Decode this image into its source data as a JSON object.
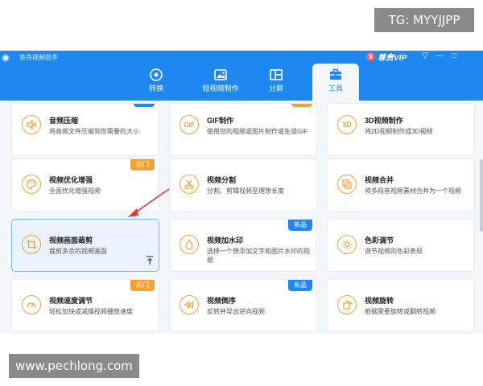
{
  "overlay": {
    "top_right": "TG: MYYJJPP",
    "bottom_left": "www.pechlong.com"
  },
  "window": {
    "title": "金舟视频助手",
    "vip_label": "尊贵VIP",
    "controls": [
      "▽",
      "—",
      "□"
    ]
  },
  "tabs": [
    {
      "label": "转换",
      "icon": "convert-icon",
      "active": false
    },
    {
      "label": "短视频制作",
      "icon": "short-video-icon",
      "active": false
    },
    {
      "label": "分屏",
      "icon": "split-screen-icon",
      "active": false
    },
    {
      "label": "工具",
      "icon": "toolbox-icon",
      "active": true
    }
  ],
  "cards": [
    {
      "title": "音频压缩",
      "desc": "将音频文件压缩到您需要的大小",
      "icon": "audio-compress-icon",
      "badge": "blank-blue"
    },
    {
      "title": "GIF制作",
      "desc": "使用您的视频或图片制作或生成GIF",
      "icon": "gif-icon",
      "icon_text": "GIF",
      "badge": "blank-orange"
    },
    {
      "title": "3D视频制作",
      "desc": "将2D视频制作成3D视频",
      "icon": "3d-icon",
      "icon_text": "3D",
      "badge": ""
    },
    {
      "title": "视频优化增强",
      "desc": "全面优化增强视频",
      "icon": "palette-icon",
      "badge": "热门"
    },
    {
      "title": "视频分割",
      "desc": "分割、剪辑视频至理想长度",
      "icon": "scissors-icon",
      "badge": ""
    },
    {
      "title": "视频合并",
      "desc": "将多段音视频素材合并为一个视频",
      "icon": "merge-icon",
      "badge": ""
    },
    {
      "title": "视频画面裁剪",
      "desc": "裁剪多余的视频画面",
      "icon": "crop-icon",
      "badge": "",
      "selected": true
    },
    {
      "title": "视频加水印",
      "desc": "选择一个想添加文字和图片水印的视频",
      "icon": "drop-icon",
      "badge": "新品"
    },
    {
      "title": "色彩调节",
      "desc": "调节视频的色彩表现",
      "icon": "sun-icon",
      "badge": ""
    },
    {
      "title": "视频速度调节",
      "desc": "轻松加快或减慢视频播放速度",
      "icon": "speedometer-icon",
      "badge": "热门"
    },
    {
      "title": "视频倒序",
      "desc": "反转并导出逆向视频",
      "icon": "rewind-icon",
      "badge": "新品"
    },
    {
      "title": "视频旋转",
      "desc": "根据需要旋转或翻转视频",
      "icon": "rotate-icon",
      "badge": ""
    }
  ],
  "colors": {
    "header": "#1e87f0",
    "accent_orange": "#f3a233",
    "hot_badge": "#f5a032",
    "new_badge": "#1e87f0",
    "annotation_arrow": "#e53935"
  }
}
